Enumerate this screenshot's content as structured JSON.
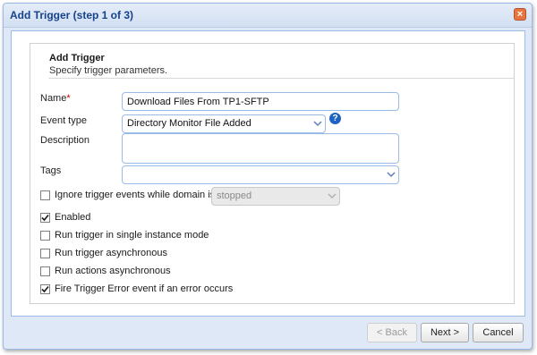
{
  "window": {
    "title": "Add Trigger (step 1 of 3)",
    "close_glyph": "×"
  },
  "section": {
    "title": "Add Trigger",
    "subtitle": "Specify trigger parameters."
  },
  "form": {
    "name_label": "Name",
    "required_mark": "*",
    "name_value": "Download Files From TP1-SFTP",
    "event_type_label": "Event type",
    "event_type_value": "Directory Monitor File Added",
    "help_glyph": "?",
    "description_label": "Description",
    "description_value": "",
    "tags_label": "Tags",
    "tags_value": "",
    "ignore_label": "Ignore trigger events while domain is",
    "ignore_checked": false,
    "ignore_value": "stopped"
  },
  "options": [
    {
      "label": "Enabled",
      "checked": true
    },
    {
      "label": "Run trigger in single instance mode",
      "checked": false
    },
    {
      "label": "Run trigger asynchronous",
      "checked": false
    },
    {
      "label": "Run actions asynchronous",
      "checked": false
    },
    {
      "label": "Fire Trigger Error event if an error occurs",
      "checked": true
    }
  ],
  "buttons": {
    "back": "< Back",
    "next": "Next >",
    "cancel": "Cancel"
  },
  "colors": {
    "title_text": "#15428b",
    "frame_bg": "#dfe8f6",
    "field_border": "#99bbe8",
    "help_icon": "#1f62c4",
    "close_button": "#e8733f"
  }
}
